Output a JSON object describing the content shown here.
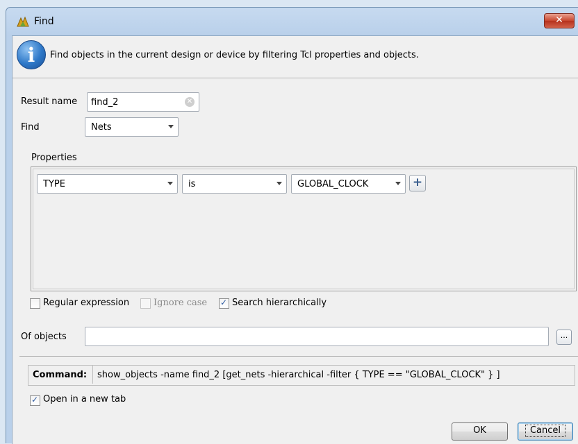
{
  "window": {
    "title": "Find"
  },
  "info": {
    "text": "Find objects in the current design or device by filtering Tcl properties and objects."
  },
  "form": {
    "result_name_label": "Result name",
    "result_name_value": "find_2",
    "find_label": "Find",
    "find_value": "Nets"
  },
  "properties": {
    "title": "Properties",
    "rows": [
      {
        "property": "TYPE",
        "operator": "is",
        "value": "GLOBAL_CLOCK"
      }
    ]
  },
  "options": {
    "regex": {
      "label": "Regular expression",
      "checked": false,
      "enabled": true
    },
    "ignore_case": {
      "label": "Ignore case",
      "checked": false,
      "enabled": false
    },
    "hierarchical": {
      "label": "Search hierarchically",
      "checked": true,
      "enabled": true
    }
  },
  "of_objects": {
    "label": "Of objects",
    "value": "",
    "browse_label": "..."
  },
  "command": {
    "label": "Command:",
    "text": "show_objects -name find_2 [get_nets -hierarchical -filter { TYPE == \"GLOBAL_CLOCK\" } ]"
  },
  "open_new_tab": {
    "label": "Open in a new tab",
    "checked": true
  },
  "buttons": {
    "ok": "OK",
    "cancel": "Cancel"
  },
  "icons": {
    "app": "find-app-icon",
    "info": "info-icon",
    "close": "close-icon",
    "add": "plus-icon"
  }
}
